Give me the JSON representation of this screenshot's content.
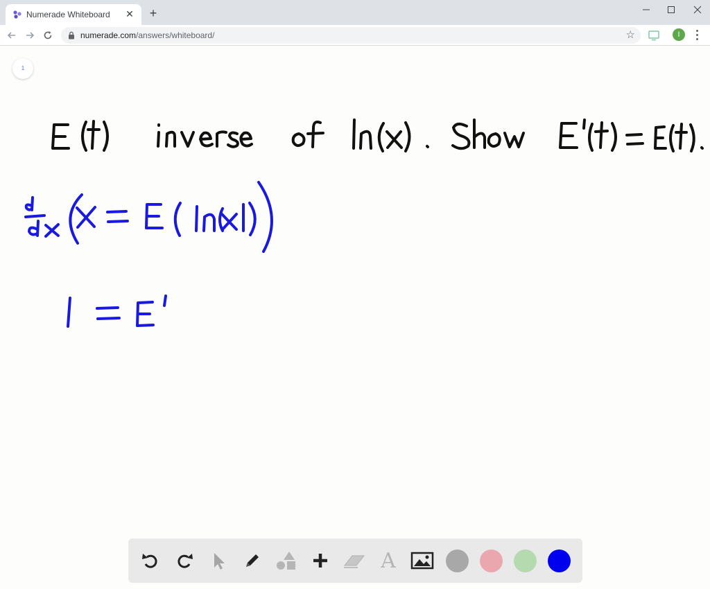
{
  "browser": {
    "tab_title": "Numerade Whiteboard",
    "tab_close": "✕",
    "new_tab": "+",
    "url_host": "numerade.com",
    "url_path": "/answers/whiteboard/",
    "profile_initial": "I"
  },
  "whiteboard": {
    "page_number": "1",
    "ink_colors": {
      "black": "#111111",
      "blue": "#1a1adf"
    },
    "handwriting": [
      "E(t)  inverse  of  ln(x) .  Show  E'(t) = E(t).",
      "d/dx ( x = E( ln(x) ) )",
      "1 = E'"
    ]
  },
  "toolbar": {
    "tools": [
      "undo-icon",
      "redo-icon",
      "select-icon",
      "pen-icon",
      "shapes-icon",
      "add-icon",
      "eraser-icon",
      "text-icon",
      "image-icon"
    ],
    "text_tool_glyph": "A",
    "colors": [
      {
        "name": "gray",
        "hex": "#a8a8a8"
      },
      {
        "name": "pink",
        "hex": "#eaa7ad"
      },
      {
        "name": "light-green",
        "hex": "#b6dab0"
      },
      {
        "name": "blue",
        "hex": "#0000ee"
      }
    ]
  }
}
